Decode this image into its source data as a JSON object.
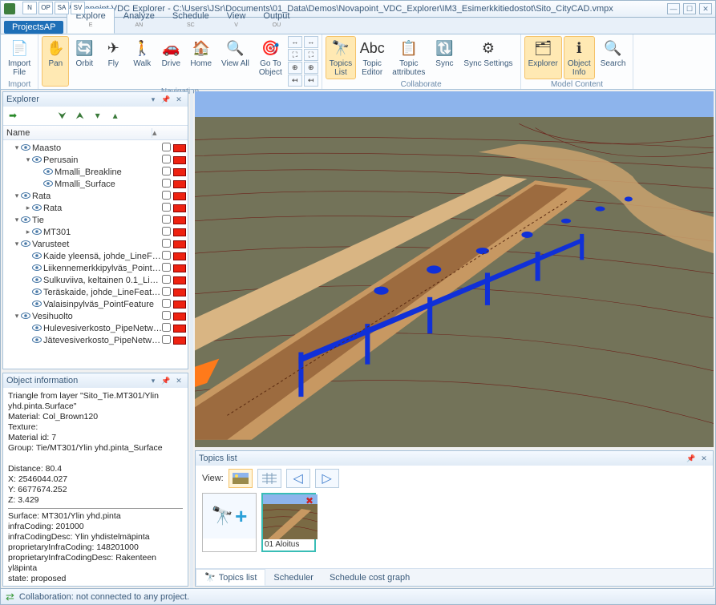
{
  "window": {
    "title": "Novapoint VDC Explorer  -  C:\\Users\\JSr\\Documents\\01_Data\\Demos\\Novapoint_VDC_Explorer\\IM3_Esimerkkitiedostot\\Sito_CityCAD.vmpx",
    "qat": [
      "N",
      "OP",
      "SA",
      "SV"
    ]
  },
  "menutabs": {
    "file": "Projects",
    "file_sub": "AP",
    "items": [
      {
        "label": "Explore",
        "sub": "E",
        "active": true
      },
      {
        "label": "Analyze",
        "sub": "AN"
      },
      {
        "label": "Schedule",
        "sub": "SC"
      },
      {
        "label": "View",
        "sub": "V"
      },
      {
        "label": "Output",
        "sub": "OU"
      }
    ]
  },
  "ribbon": {
    "groups": [
      {
        "name": "Import",
        "buttons": [
          {
            "label": "Import\nFile",
            "icon": "📄"
          }
        ]
      },
      {
        "name": "Navigation",
        "buttons": [
          {
            "label": "Pan",
            "icon": "✋",
            "sel": true
          },
          {
            "label": "Orbit",
            "icon": "🔄"
          },
          {
            "label": "Fly",
            "icon": "✈"
          },
          {
            "label": "Walk",
            "icon": "🚶"
          },
          {
            "label": "Drive",
            "icon": "🚗"
          },
          {
            "label": "Home",
            "icon": "🏠"
          },
          {
            "label": "View All",
            "icon": "🔍"
          },
          {
            "label": "Go To\nObject",
            "icon": "🎯"
          }
        ],
        "extras": true
      },
      {
        "name": "Collaborate",
        "buttons": [
          {
            "label": "Topics\nList",
            "icon": "🔭",
            "sel": true
          },
          {
            "label": "Topic\nEditor",
            "icon": "Abc"
          },
          {
            "label": "Topic\nattributes",
            "icon": "📋"
          },
          {
            "label": "Sync",
            "icon": "🔃"
          },
          {
            "label": "Sync Settings",
            "icon": "⚙"
          }
        ]
      },
      {
        "name": "Model Content",
        "buttons": [
          {
            "label": "Explorer",
            "icon": "🗂",
            "sel": true
          },
          {
            "label": "Object\nInfo",
            "icon": "ℹ",
            "sel": true
          },
          {
            "label": "Search",
            "icon": "🔍"
          }
        ]
      }
    ]
  },
  "explorer": {
    "title": "Explorer",
    "col": "Name",
    "tree": [
      {
        "d": 1,
        "tw": "▾",
        "eye": 1,
        "label": "Maasto"
      },
      {
        "d": 2,
        "tw": "▾",
        "eye": 1,
        "label": "Perusain"
      },
      {
        "d": 3,
        "tw": "",
        "eye": 1,
        "label": "Mmalli_Breakline"
      },
      {
        "d": 3,
        "tw": "",
        "eye": 1,
        "label": "Mmalli_Surface"
      },
      {
        "d": 1,
        "tw": "▾",
        "eye": 1,
        "label": "Rata"
      },
      {
        "d": 2,
        "tw": "▸",
        "eye": 1,
        "label": "Rata"
      },
      {
        "d": 1,
        "tw": "▾",
        "eye": 1,
        "label": "Tie"
      },
      {
        "d": 2,
        "tw": "▸",
        "eye": 1,
        "label": "MT301"
      },
      {
        "d": 1,
        "tw": "▾",
        "eye": 1,
        "label": "Varusteet"
      },
      {
        "d": 2,
        "tw": "",
        "eye": 1,
        "label": "Kaide yleensä, johde_LineFeature"
      },
      {
        "d": 2,
        "tw": "",
        "eye": 1,
        "label": "Liikennemerkkipylväs_PointFeature"
      },
      {
        "d": 2,
        "tw": "",
        "eye": 1,
        "label": "Sulkuviiva, keltainen 0.1_LineFeature"
      },
      {
        "d": 2,
        "tw": "",
        "eye": 1,
        "label": "Teräskaide, johde_LineFeature"
      },
      {
        "d": 2,
        "tw": "",
        "eye": 1,
        "label": "Valaisinpylväs_PointFeature"
      },
      {
        "d": 1,
        "tw": "▾",
        "eye": 1,
        "label": "Vesihuolto"
      },
      {
        "d": 2,
        "tw": "",
        "eye": 1,
        "label": "Hulevesiverkosto_PipeNetwork"
      },
      {
        "d": 2,
        "tw": "",
        "eye": 1,
        "label": "Jätevesiverkosto_PipeNetwork"
      }
    ]
  },
  "objinfo": {
    "title": "Object information",
    "lines": {
      "l1": "Triangle from layer \"Sito_Tie.MT301/Ylin yhd.pinta.Surface\"",
      "l2": "Material: Col_Brown120",
      "l3": "Texture:",
      "l4": "Material id: 7",
      "l5": "Group: Tie/MT301/Ylin yhd.pinta_Surface",
      "l6": "Distance:    80.4",
      "l7": "X: 2546044.027",
      "l8": "Y: 6677674.252",
      "l9": "Z: 3.429",
      "l10": "Surface: MT301/Ylin yhd.pinta",
      "l11": "infraCoding: 201000",
      "l12": "infraCodingDesc: Ylin yhdistelmäpinta",
      "l13": "proprietaryInfraCoding: 148201000",
      "l14": "proprietaryInfraCodingDesc: Rakenteen yläpinta",
      "l15": "state: proposed"
    }
  },
  "topics": {
    "title": "Topics list",
    "viewlabel": "View:",
    "addlabel": "",
    "cards": [
      {
        "label": "01 Aloitus"
      }
    ],
    "tabs": [
      {
        "label": "Topics list",
        "active": true
      },
      {
        "label": "Scheduler"
      },
      {
        "label": "Schedule cost graph"
      }
    ]
  },
  "status": {
    "text": "Collaboration: not connected to any project."
  }
}
